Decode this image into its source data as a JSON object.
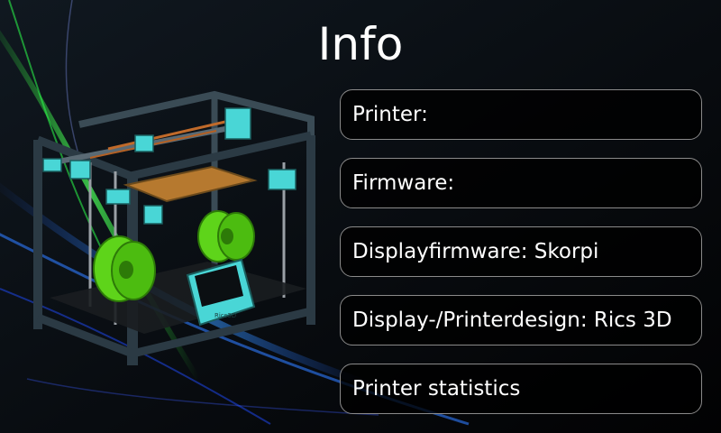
{
  "screen": {
    "title": "Info"
  },
  "items": [
    {
      "label": "Printer:",
      "value": ""
    },
    {
      "label": "Firmware:",
      "value": ""
    },
    {
      "label": "Displayfirmware:",
      "value": "Skorpi"
    },
    {
      "label": "Display-/Printerdesign:",
      "value": "Rics 3D"
    },
    {
      "label": "Printer statistics",
      "value": ""
    }
  ],
  "colors": {
    "background": "#050507",
    "frame": "#2b3a44",
    "parts": "#49d6d6",
    "spool": "#5ed41a",
    "bed": "#b6792f",
    "text": "#ffffff",
    "box_border": "#8a8a8a"
  },
  "image": {
    "subject": "3d-printer-render",
    "display_text": "Rics3D"
  }
}
